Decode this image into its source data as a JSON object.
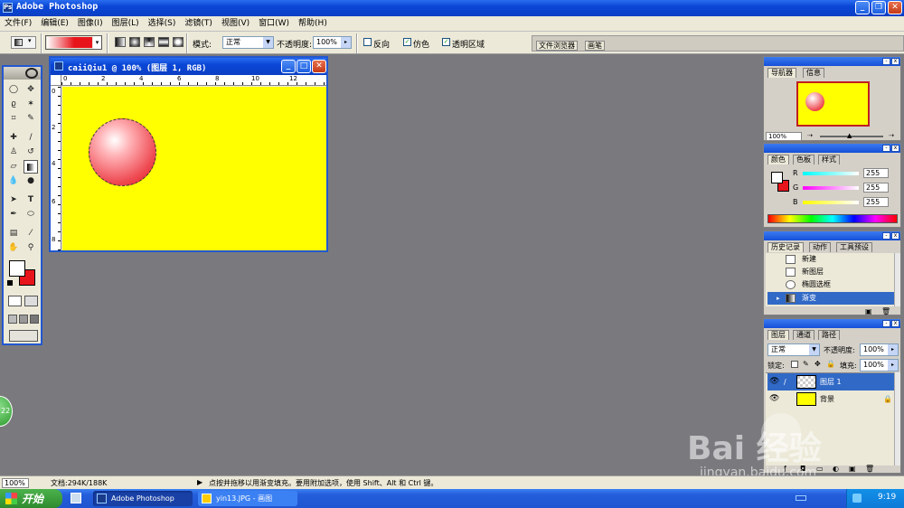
{
  "app": {
    "title": "Adobe Photoshop"
  },
  "menu": [
    "文件(F)",
    "编辑(E)",
    "图像(I)",
    "图层(L)",
    "选择(S)",
    "滤镜(T)",
    "视图(V)",
    "窗口(W)",
    "帮助(H)"
  ],
  "options": {
    "mode_label": "模式:",
    "mode_value": "正常",
    "opacity_label": "不透明度:",
    "opacity_value": "100%",
    "reverse_label": "反向",
    "dither_label": "仿色",
    "transparency_label": "透明区域",
    "tabs": [
      "文件浏览器",
      "画笔"
    ]
  },
  "document": {
    "title": "caiiQiu1 @ 100% (图层 1, RGB)",
    "ruler_numbers": [
      "0",
      "2",
      "4",
      "6",
      "8",
      "10",
      "12"
    ],
    "canvas_color": "#ffff00"
  },
  "navigator": {
    "tabs": [
      "导航器",
      "信息"
    ],
    "zoom": "100%"
  },
  "color_panel": {
    "tabs": [
      "颜色",
      "色板",
      "样式"
    ],
    "channels": [
      {
        "label": "R",
        "value": "255"
      },
      {
        "label": "G",
        "value": "255"
      },
      {
        "label": "B",
        "value": "255"
      }
    ]
  },
  "history": {
    "tabs": [
      "历史记录",
      "动作",
      "工具预设"
    ],
    "items": [
      "新建",
      "新图层",
      "椭圆选框",
      "渐变"
    ]
  },
  "layers": {
    "tabs": [
      "图层",
      "通道",
      "路径"
    ],
    "blend_mode": "正常",
    "opacity_label": "不透明度:",
    "opacity_value": "100%",
    "lock_label": "锁定:",
    "fill_label": "填充:",
    "fill_value": "100%",
    "items": [
      "图层 1",
      "背景"
    ]
  },
  "status": {
    "zoom": "100%",
    "doc_info": "文档:294K/188K",
    "hint": "点按并拖移以用渐变填充。要用附加选项，使用 Shift、Alt 和 Ctrl 键。"
  },
  "watermark": {
    "text": "Bai 经验",
    "sub": "jingyan.baidu.com"
  },
  "taskbar": {
    "start": "开始",
    "items": [
      "Adobe Photoshop",
      "yin13.JPG - 画图"
    ],
    "clock": "9:19"
  },
  "colors": {
    "selection_red": "#e8141c",
    "active_blue": "#3169c6"
  }
}
